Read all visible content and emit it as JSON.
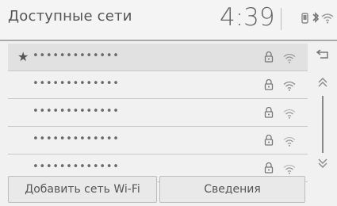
{
  "header": {
    "title": "Доступные сети",
    "time": "4:39",
    "status_bluetooth": "ʙ"
  },
  "networks": [
    {
      "ssid": "•••••••••••••",
      "favorite": true,
      "lock": "lock-icon",
      "signal": "wifi-signal-icon"
    },
    {
      "ssid": "•••••••••••••",
      "favorite": false,
      "lock": "lock-icon",
      "signal": "wifi-signal-icon"
    },
    {
      "ssid": "•••••••••••••",
      "favorite": false,
      "lock": "lock-icon",
      "signal": "wifi-signal-icon"
    },
    {
      "ssid": "•••••••••••••",
      "favorite": false,
      "lock": "lock-icon",
      "signal": "wifi-signal-icon"
    },
    {
      "ssid": "•••••••••••••",
      "favorite": false,
      "lock": "lock-icon",
      "signal": "wifi-signal-icon"
    }
  ],
  "buttons": {
    "add_network": "Добавить сеть Wi-Fi",
    "details": "Сведения"
  },
  "icons": {
    "favorite": "★"
  },
  "colors": {
    "background": "#f1f1f1",
    "text": "#555555",
    "row_selected": "#e1e1e1"
  }
}
